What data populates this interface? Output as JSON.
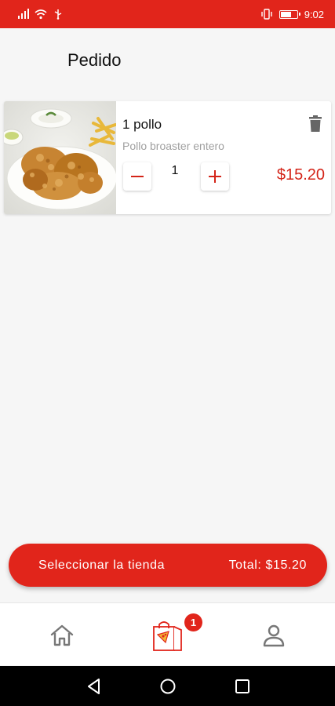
{
  "status_bar": {
    "time": "9:02",
    "icons": [
      "signal-icon",
      "wifi-icon",
      "usb-icon",
      "vibrate-icon",
      "battery-icon"
    ]
  },
  "page": {
    "title": "Pedido"
  },
  "cart": {
    "items": [
      {
        "name": "1 pollo",
        "description": "Pollo broaster entero",
        "quantity": "1",
        "price": "$15.20",
        "image": "fried-chicken-photo"
      }
    ]
  },
  "checkout": {
    "label": "Seleccionar la tienda",
    "total": "Total: $15.20"
  },
  "bottom_nav": {
    "items": [
      {
        "name": "home",
        "icon": "home-icon"
      },
      {
        "name": "cart",
        "icon": "shopping-bag-icon",
        "badge": "1"
      },
      {
        "name": "profile",
        "icon": "user-icon"
      }
    ]
  },
  "colors": {
    "primary": "#e1251b",
    "price": "#d42418",
    "muted_text": "#a0a0a0",
    "background": "#f6f6f6"
  }
}
